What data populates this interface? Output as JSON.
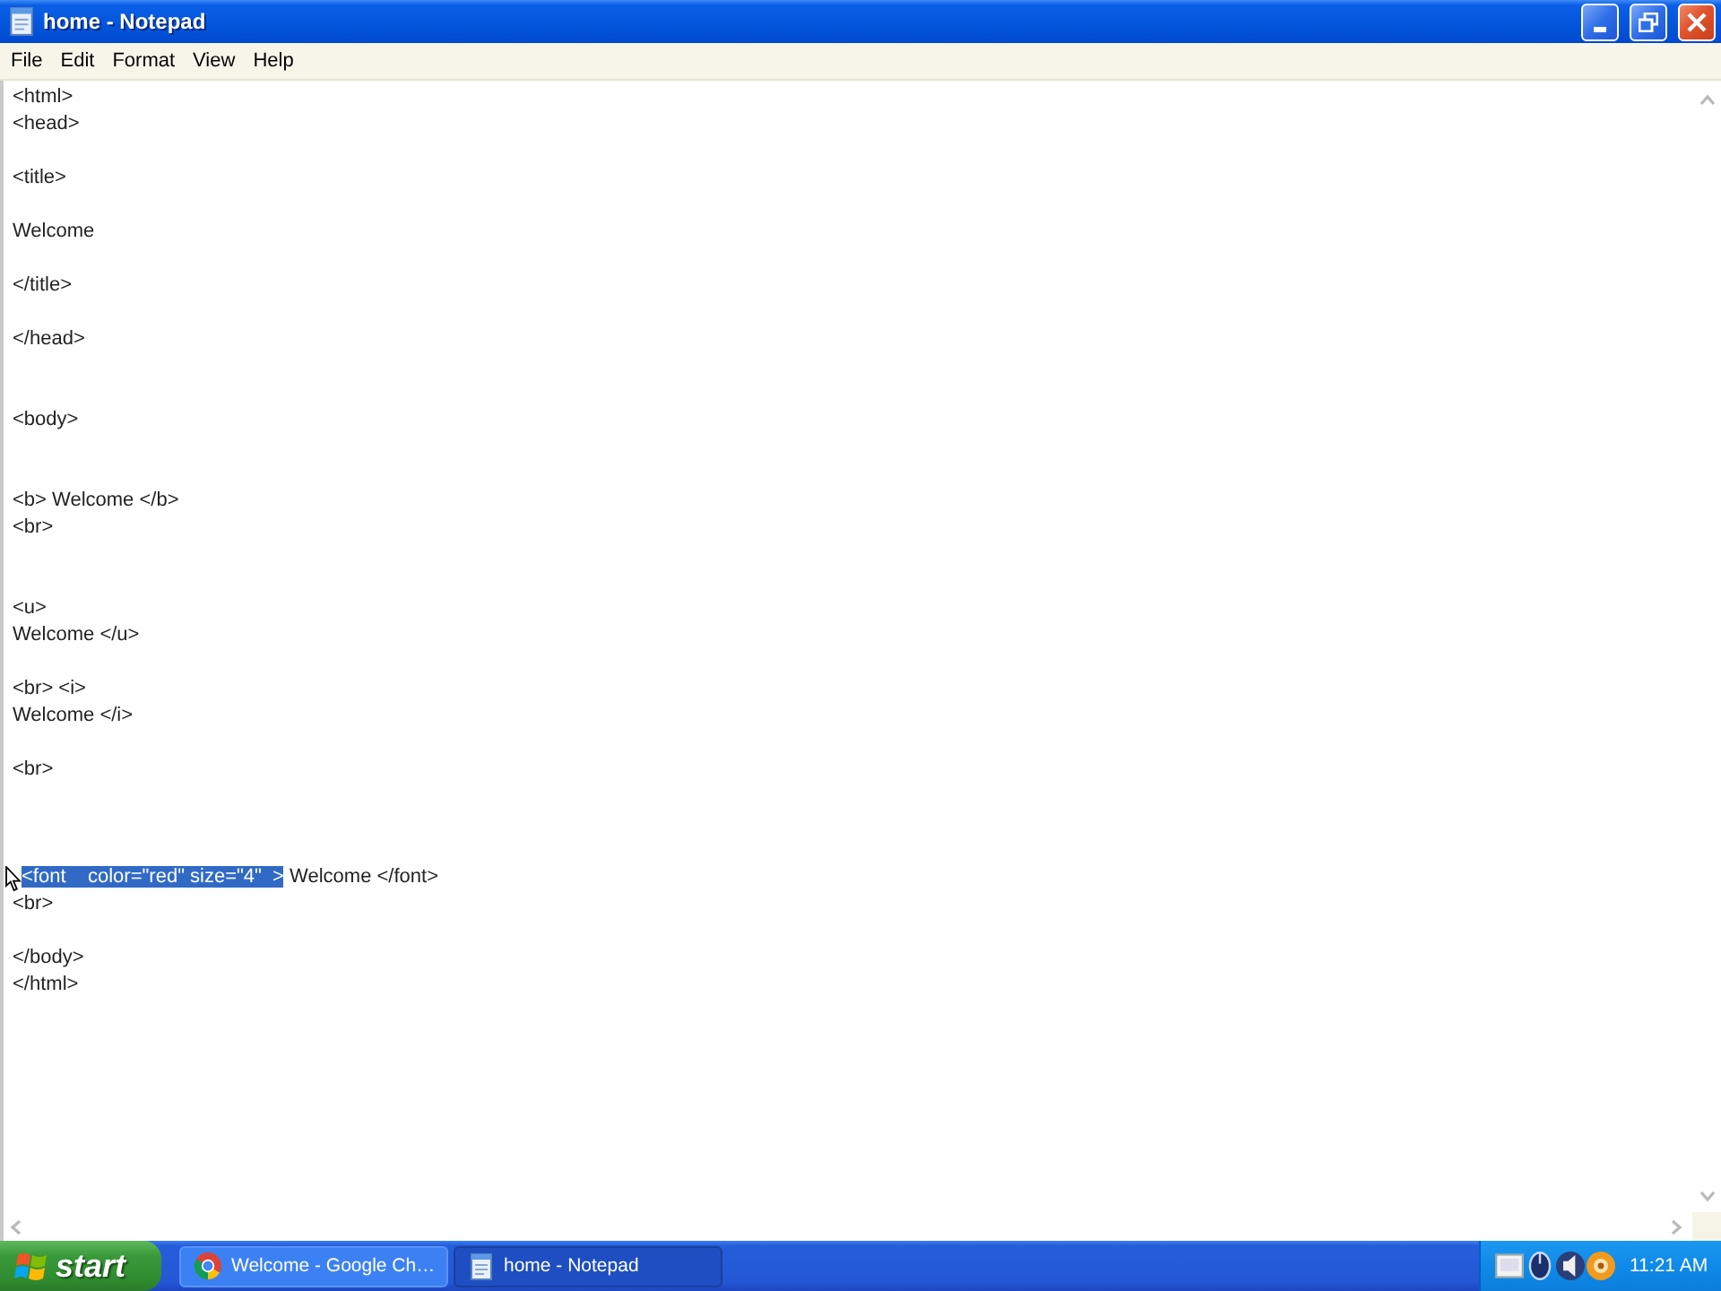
{
  "window": {
    "title": "home - Notepad",
    "buttons": [
      {
        "kind": "minimize"
      },
      {
        "kind": "restore"
      },
      {
        "kind": "close"
      }
    ]
  },
  "menu": [
    "File",
    "Edit",
    "Format",
    "View",
    "Help"
  ],
  "editor": {
    "lines": [
      {
        "kind": "text",
        "text": "<html>"
      },
      {
        "kind": "text",
        "text": "<head>"
      },
      {
        "kind": "blank"
      },
      {
        "kind": "text",
        "text": "<title>"
      },
      {
        "kind": "blank"
      },
      {
        "kind": "text",
        "text": "Welcome"
      },
      {
        "kind": "blank"
      },
      {
        "kind": "text",
        "text": "</title>"
      },
      {
        "kind": "blank"
      },
      {
        "kind": "text",
        "text": "</head>"
      },
      {
        "kind": "blank"
      },
      {
        "kind": "blank"
      },
      {
        "kind": "text",
        "text": "<body>"
      },
      {
        "kind": "blank"
      },
      {
        "kind": "blank"
      },
      {
        "kind": "text",
        "text": "<b> Welcome </b>"
      },
      {
        "kind": "text",
        "text": "<br>"
      },
      {
        "kind": "blank"
      },
      {
        "kind": "blank"
      },
      {
        "kind": "text",
        "text": "<u>"
      },
      {
        "kind": "text",
        "text": "Welcome </u>"
      },
      {
        "kind": "blank"
      },
      {
        "kind": "text",
        "text": "<br> <i>"
      },
      {
        "kind": "text",
        "text": "Welcome </i>"
      },
      {
        "kind": "blank"
      },
      {
        "kind": "text",
        "text": "<br>"
      },
      {
        "kind": "blank"
      },
      {
        "kind": "blank"
      },
      {
        "kind": "blank"
      },
      {
        "kind": "mixed",
        "segments": [
          {
            "text": "<font    color=\"red\" size=\"4\"  >",
            "selected": true
          },
          {
            "text": " Welcome </font>",
            "selected": false
          }
        ]
      },
      {
        "kind": "text",
        "text": "<br>"
      },
      {
        "kind": "blank"
      },
      {
        "kind": "text",
        "text": "</body>"
      },
      {
        "kind": "text",
        "text": "</html>"
      }
    ]
  },
  "taskbar": {
    "start_label": "start",
    "tasks": [
      {
        "kind": "browser",
        "label": "Welcome - Google Ch…",
        "selected": false
      },
      {
        "kind": "notepad",
        "label": "home - Notepad",
        "selected": true
      }
    ],
    "time": "11:21 AM"
  }
}
